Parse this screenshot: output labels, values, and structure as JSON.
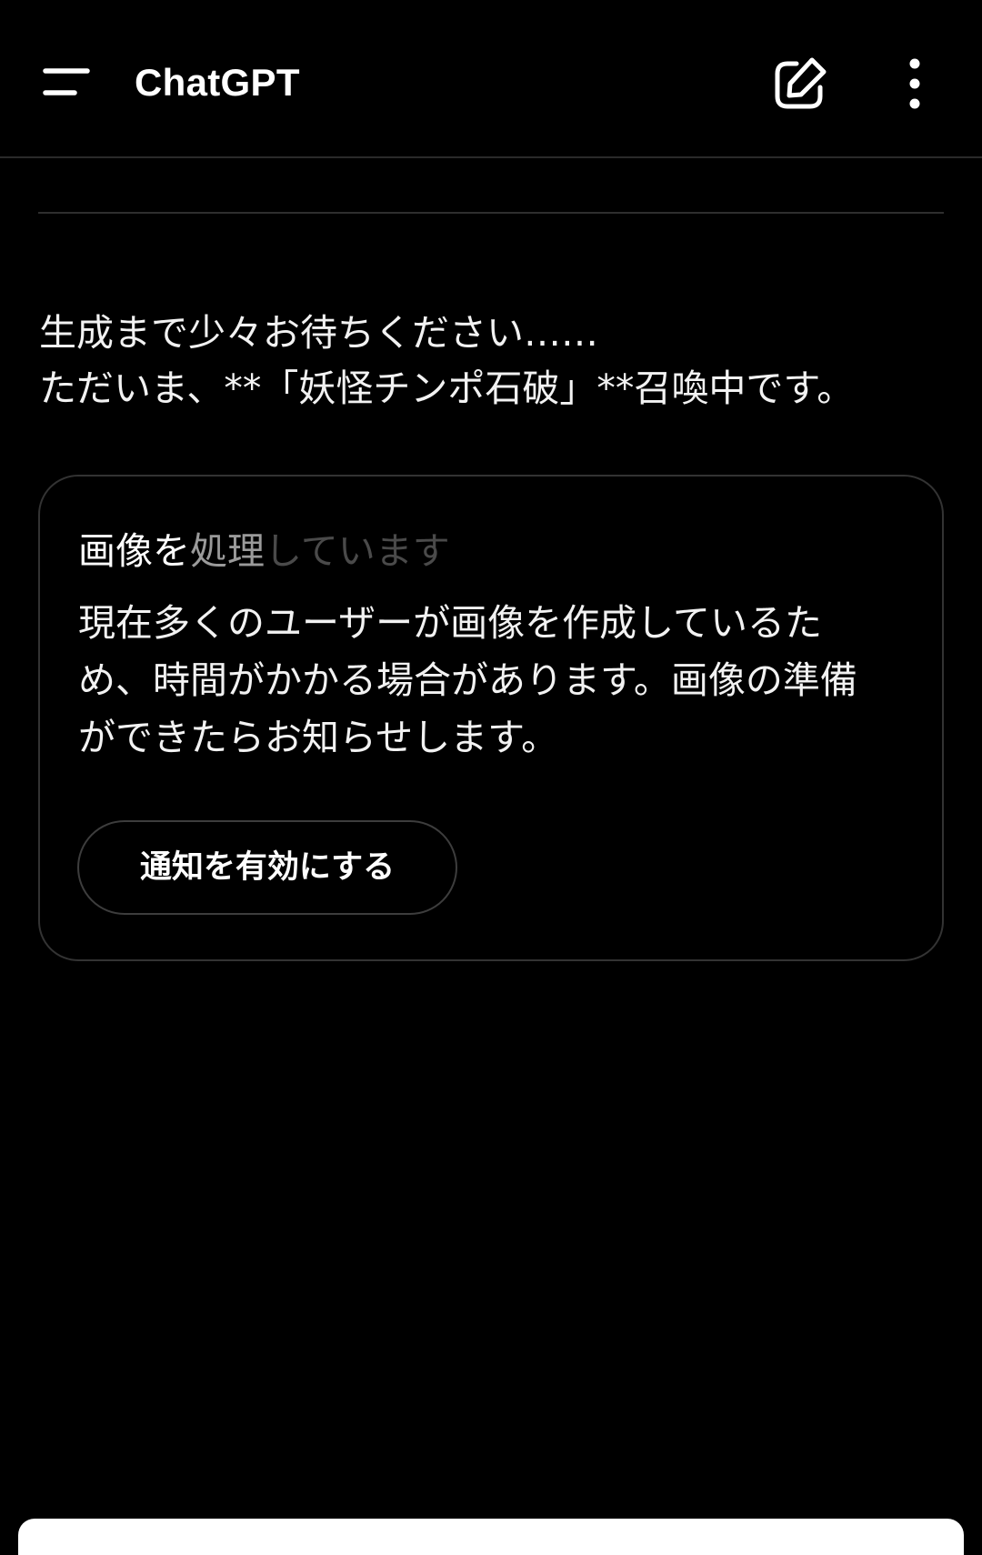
{
  "header": {
    "title": "ChatGPT",
    "menu_icon": "menu-icon",
    "new_chat_icon": "edit-icon",
    "more_icon": "more-vertical-icon"
  },
  "message": {
    "lines": [
      "生成まで少々お待ちください……",
      "ただいま、**「妖怪チンポ石破」**召喚中です。"
    ]
  },
  "card": {
    "heading": {
      "bright": "画像を",
      "mid": "処理",
      "dim": "しています"
    },
    "body_lines": [
      "現在多くのユーザーが画像を作成しているた",
      "め、時間がかかる場合があります。画像の準備",
      "ができたらお知らせします。"
    ],
    "button_label": "通知を有効にする"
  },
  "colors": {
    "background": "#000000",
    "text": "#ffffff",
    "border": "#333333"
  }
}
